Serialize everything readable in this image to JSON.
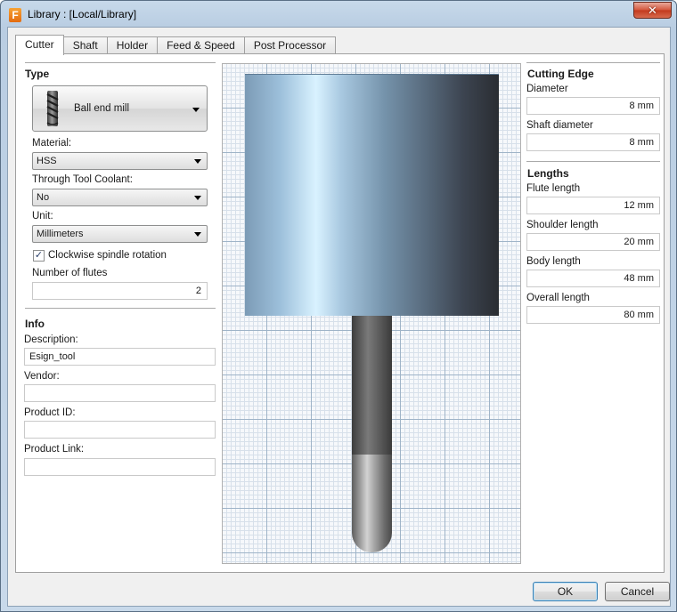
{
  "window": {
    "app_icon_letter": "F",
    "title": "Library : [Local/Library]",
    "close_glyph": "✕"
  },
  "tabs": [
    {
      "label": "Cutter",
      "active": true
    },
    {
      "label": "Shaft",
      "active": false
    },
    {
      "label": "Holder",
      "active": false
    },
    {
      "label": "Feed & Speed",
      "active": false
    },
    {
      "label": "Post Processor",
      "active": false
    }
  ],
  "type_section": {
    "title": "Type",
    "tool_type": "Ball end mill",
    "tool_icon": "end-mill-icon",
    "material_label": "Material:",
    "material_value": "HSS",
    "coolant_label": "Through Tool Coolant:",
    "coolant_value": "No",
    "unit_label": "Unit:",
    "unit_value": "Millimeters",
    "clockwise_label": "Clockwise spindle rotation",
    "clockwise_checked": true,
    "flutes_label": "Number of flutes",
    "flutes_value": "2"
  },
  "info_section": {
    "title": "Info",
    "description_label": "Description:",
    "description_value": "Esign_tool",
    "vendor_label": "Vendor:",
    "vendor_value": "",
    "product_id_label": "Product ID:",
    "product_id_value": "",
    "product_link_label": "Product Link:",
    "product_link_value": ""
  },
  "cutting_edge": {
    "title": "Cutting Edge",
    "diameter_label": "Diameter",
    "diameter_value": "8 mm",
    "shaft_diameter_label": "Shaft diameter",
    "shaft_diameter_value": "8 mm"
  },
  "lengths": {
    "title": "Lengths",
    "flute_length_label": "Flute length",
    "flute_length_value": "12 mm",
    "shoulder_length_label": "Shoulder length",
    "shoulder_length_value": "20 mm",
    "body_length_label": "Body length",
    "body_length_value": "48 mm",
    "overall_length_label": "Overall length",
    "overall_length_value": "80 mm"
  },
  "footer": {
    "ok_label": "OK",
    "cancel_label": "Cancel"
  }
}
